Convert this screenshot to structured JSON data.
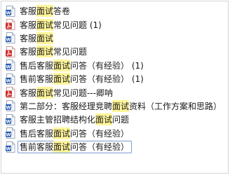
{
  "highlight_color": "#fff59a",
  "files": [
    {
      "icon": "word-doc-icon",
      "segments": [
        {
          "text": "客服",
          "hl": false
        },
        {
          "text": "面试",
          "hl": true
        },
        {
          "text": "答卷",
          "hl": false
        }
      ]
    },
    {
      "icon": "pdf-doc-icon",
      "segments": [
        {
          "text": "客服",
          "hl": false
        },
        {
          "text": "面试",
          "hl": true
        },
        {
          "text": "常见问题 (1)",
          "hl": false
        }
      ]
    },
    {
      "icon": "word-doc-icon",
      "segments": [
        {
          "text": "客服",
          "hl": false
        },
        {
          "text": "面试",
          "hl": true
        }
      ]
    },
    {
      "icon": "pdf-doc-icon",
      "segments": [
        {
          "text": "客服",
          "hl": false
        },
        {
          "text": "面试",
          "hl": true
        },
        {
          "text": "常见问题",
          "hl": false
        }
      ]
    },
    {
      "icon": "word-doc-icon",
      "segments": [
        {
          "text": "售后客服",
          "hl": false
        },
        {
          "text": "面试",
          "hl": true
        },
        {
          "text": "问答（有经验） (1)",
          "hl": false
        }
      ]
    },
    {
      "icon": "word-doc-icon",
      "segments": [
        {
          "text": "售前客服",
          "hl": false
        },
        {
          "text": "面试",
          "hl": true
        },
        {
          "text": "问答（有经验） (1)",
          "hl": false
        }
      ]
    },
    {
      "icon": "pdf-doc-icon",
      "segments": [
        {
          "text": "客服",
          "hl": false
        },
        {
          "text": "面试",
          "hl": true
        },
        {
          "text": "常见问题---卿呐",
          "hl": false
        }
      ]
    },
    {
      "icon": "word-doc-icon",
      "segments": [
        {
          "text": "第二部分：客服经理竞聘",
          "hl": false
        },
        {
          "text": "面试",
          "hl": true
        },
        {
          "text": "资料（工作方案和思路）",
          "hl": false
        }
      ]
    },
    {
      "icon": "word-doc-icon",
      "segments": [
        {
          "text": "客服主管招聘结构化",
          "hl": false
        },
        {
          "text": "面试",
          "hl": true
        },
        {
          "text": "问题",
          "hl": false
        }
      ]
    },
    {
      "icon": "word-doc-icon",
      "segments": [
        {
          "text": "售后客服",
          "hl": false
        },
        {
          "text": "面试",
          "hl": true
        },
        {
          "text": "问答（有经验）",
          "hl": false
        }
      ]
    },
    {
      "icon": "word-doc-icon",
      "selected": true,
      "segments": [
        {
          "text": "售前客服",
          "hl": false
        },
        {
          "text": "面试",
          "hl": true
        },
        {
          "text": "问答（有经验）",
          "hl": false
        }
      ]
    }
  ]
}
